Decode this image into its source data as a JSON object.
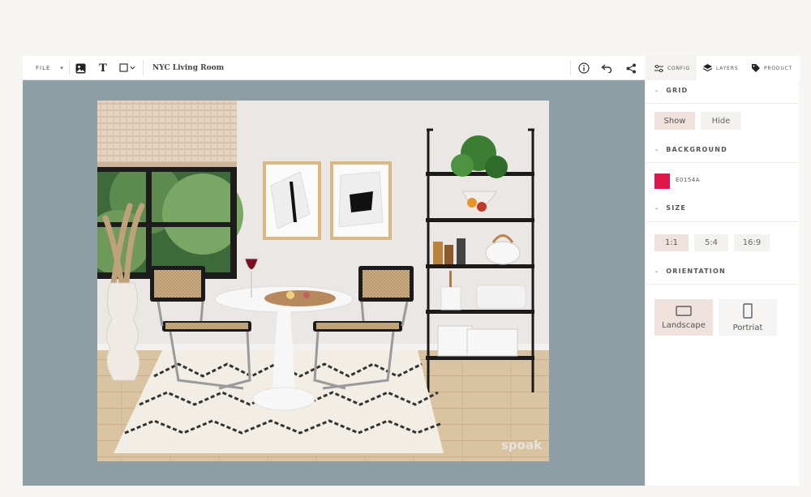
{
  "toolbar": {
    "file_label": "FILE",
    "caret": "▾",
    "text_tool": "T",
    "project_title": "NYC Living Room"
  },
  "panel": {
    "tabs": [
      {
        "label": "CONFIG",
        "icon": "sliders-icon"
      },
      {
        "label": "LAYERS",
        "icon": "layers-icon"
      },
      {
        "label": "PRODUCT",
        "icon": "tag-icon"
      }
    ],
    "active_tab": "LAYERS",
    "chevron": "⌄",
    "grid": {
      "heading": "GRID",
      "options": [
        "Show",
        "Hide"
      ],
      "selected": "Show"
    },
    "background": {
      "heading": "BACKGROUND",
      "hex": "E0154A",
      "color": "#e0154a"
    },
    "size": {
      "heading": "SIZE",
      "options": [
        "1:1",
        "5:4",
        "16:9"
      ],
      "selected": "1:1"
    },
    "orientation": {
      "heading": "ORIENTATION",
      "options": [
        "Landscape",
        "Portriat"
      ],
      "selected": "Landscape"
    }
  },
  "canvas": {
    "background_color": "#8d9ea5",
    "watermark": "spoak"
  }
}
